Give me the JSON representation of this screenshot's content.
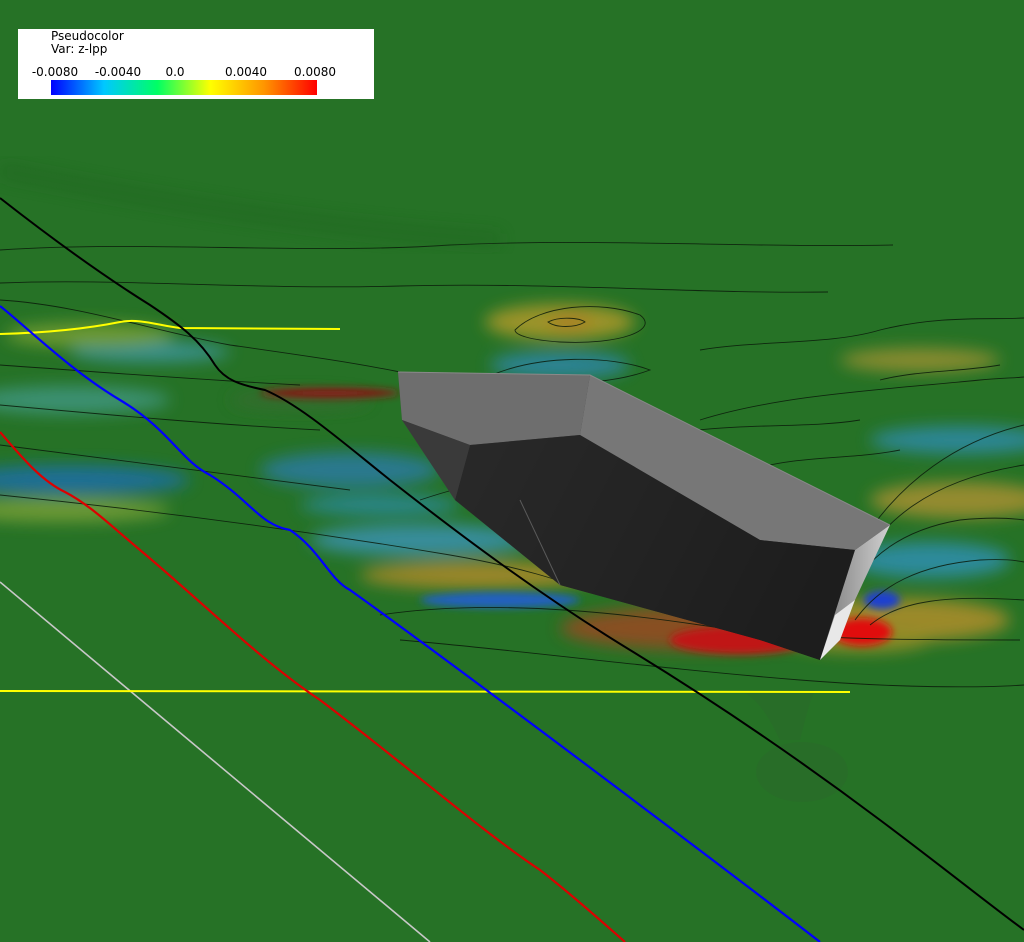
{
  "legend": {
    "title": "Pseudocolor",
    "var_label": "Var: z-lpp",
    "ticks": [
      "-0.0080",
      "-0.0040",
      "0.0",
      "0.0040",
      "0.0080"
    ],
    "colormap": [
      "#0000ff",
      "#00c8ff",
      "#00ff64",
      "#ffff00",
      "#ff9600",
      "#ff0000"
    ]
  },
  "scene": {
    "background_color": "#267226",
    "hull_color": "#3c3c3c",
    "deck_color": "#6e6e6e",
    "line_colors": {
      "yellow": "#ffff00",
      "blue": "#0000ff",
      "red": "#dd0000",
      "black": "#000000",
      "white": "#c8c8c8"
    }
  }
}
